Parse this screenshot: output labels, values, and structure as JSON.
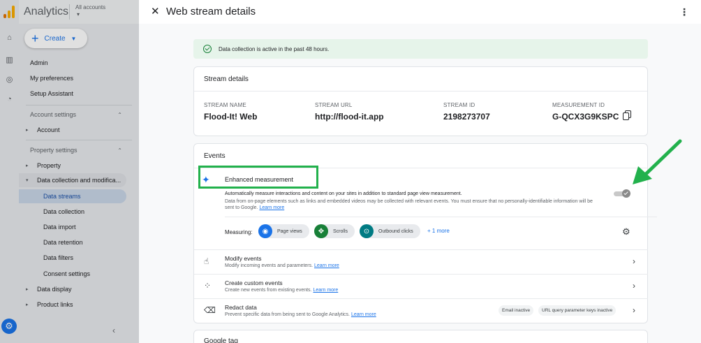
{
  "app": {
    "title": "Analytics",
    "account_label": "All accounts",
    "account_caret": "▾"
  },
  "sidebar": {
    "create_label": "Create",
    "items": [
      {
        "label": "Admin"
      },
      {
        "label": "My preferences"
      },
      {
        "label": "Setup Assistant"
      },
      {
        "label": "Account settings"
      },
      {
        "label": "Account"
      },
      {
        "label": "Property settings"
      },
      {
        "label": "Property"
      },
      {
        "label": "Data collection and modifica..."
      },
      {
        "label": "Data streams"
      },
      {
        "label": "Data collection"
      },
      {
        "label": "Data import"
      },
      {
        "label": "Data retention"
      },
      {
        "label": "Data filters"
      },
      {
        "label": "Consent settings"
      },
      {
        "label": "Data display"
      },
      {
        "label": "Product links"
      }
    ]
  },
  "panel": {
    "title": "Web stream details",
    "banner": "Data collection is active in the past 48 hours.",
    "stream_details": {
      "title": "Stream details",
      "fields": [
        {
          "label": "STREAM NAME",
          "value": "Flood-It! Web"
        },
        {
          "label": "STREAM URL",
          "value": "http://flood-it.app"
        },
        {
          "label": "STREAM ID",
          "value": "2198273707"
        },
        {
          "label": "MEASUREMENT ID",
          "value": "G-QCX3G9KSPC"
        }
      ]
    },
    "events": {
      "title": "Events",
      "enhanced": {
        "title": "Enhanced measurement",
        "desc1": "Automatically measure interactions and content on your sites in addition to standard page view measurement.",
        "desc2": "Data from on-page elements such as links and embedded videos may be collected with relevant events. You must ensure that no personally-identifiable information will be sent to Google.",
        "learn_more": "Learn more",
        "toggle_on": true,
        "measuring_label": "Measuring:",
        "chips": [
          {
            "label": "Page views",
            "color": "#1a73e8",
            "icon": "eye-icon"
          },
          {
            "label": "Scrolls",
            "color": "#188038",
            "icon": "crosshair-icon"
          },
          {
            "label": "Outbound clicks",
            "color": "#007b83",
            "icon": "mouse-icon"
          }
        ],
        "more": "+ 1 more"
      },
      "rows": [
        {
          "title": "Modify events",
          "sub": "Modify incoming events and parameters.",
          "link": "Learn more"
        },
        {
          "title": "Create custom events",
          "sub": "Create new events from existing events.",
          "link": "Learn more"
        },
        {
          "title": "Redact data",
          "sub": "Prevent specific data from being sent to Google Analytics.",
          "link": "Learn more",
          "pills": [
            "Email inactive",
            "URL query parameter keys inactive"
          ]
        }
      ]
    },
    "google_tag": {
      "title": "Google tag"
    }
  },
  "colors": {
    "accent": "#1a73e8",
    "highlight": "#22b14c",
    "banner_bg": "#e6f4ea"
  }
}
